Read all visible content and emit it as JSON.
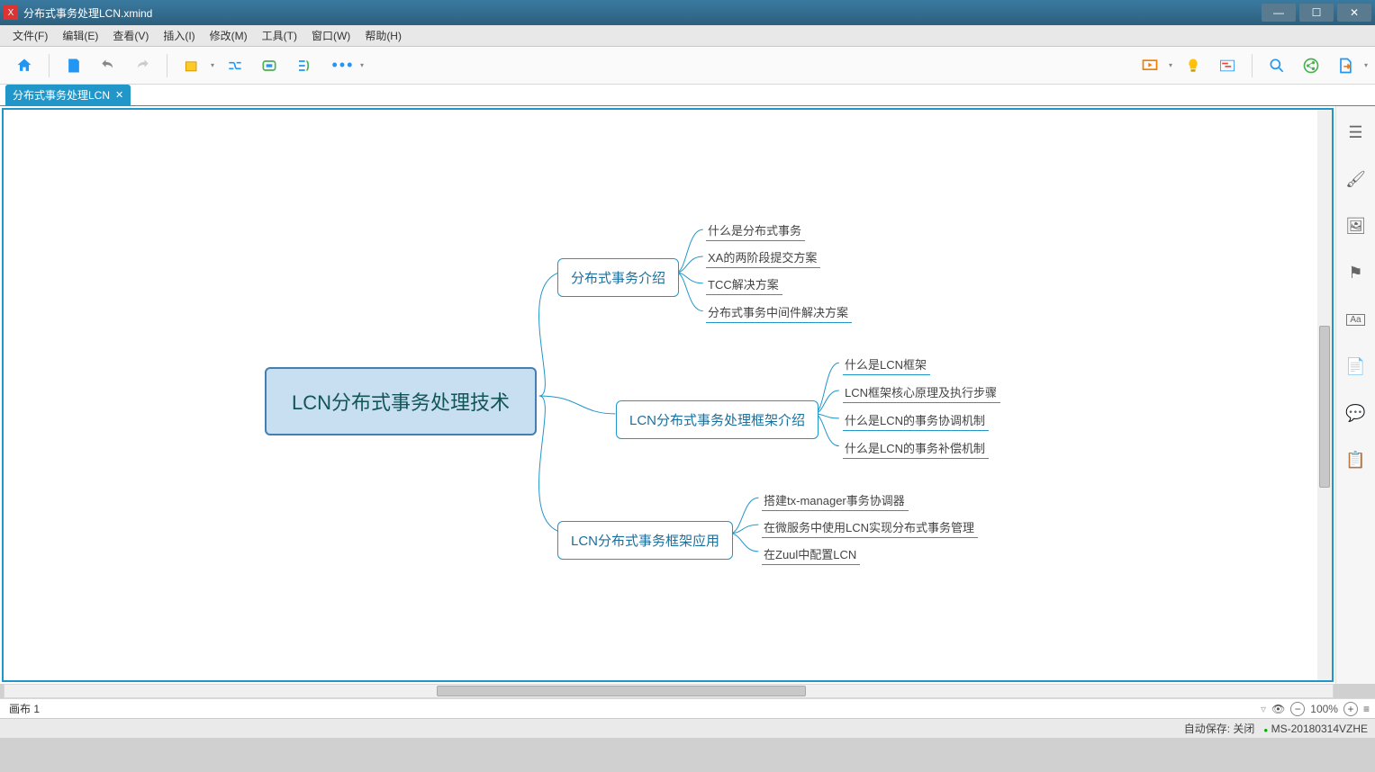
{
  "window": {
    "title": "分布式事务处理LCN.xmind"
  },
  "menu": [
    "文件(F)",
    "编辑(E)",
    "查看(V)",
    "插入(I)",
    "修改(M)",
    "工具(T)",
    "窗口(W)",
    "帮助(H)"
  ],
  "tab": {
    "label": "分布式事务处理LCN"
  },
  "sheet": {
    "label": "画布 1"
  },
  "zoom": {
    "value": "100%"
  },
  "status": {
    "autosave": "自动保存: 关闭",
    "host": "MS-20180314VZHE"
  },
  "mindmap": {
    "root": "LCN分布式事务处理技术",
    "branches": [
      {
        "title": "分布式事务介绍",
        "leaves": [
          "什么是分布式事务",
          "XA的两阶段提交方案",
          "TCC解决方案",
          "分布式事务中间件解决方案"
        ]
      },
      {
        "title": "LCN分布式事务处理框架介绍",
        "leaves": [
          "什么是LCN框架",
          "LCN框架核心原理及执行步骤",
          "什么是LCN的事务协调机制",
          "什么是LCN的事务补偿机制"
        ]
      },
      {
        "title": "LCN分布式事务框架应用",
        "leaves": [
          "搭建tx-manager事务协调器",
          "在微服务中使用LCN实现分布式事务管理",
          "在Zuul中配置LCN"
        ]
      }
    ]
  },
  "chart_data": {
    "type": "table",
    "title": "LCN分布式事务处理技术",
    "series": [
      {
        "name": "分布式事务介绍",
        "values": [
          "什么是分布式事务",
          "XA的两阶段提交方案",
          "TCC解决方案",
          "分布式事务中间件解决方案"
        ]
      },
      {
        "name": "LCN分布式事务处理框架介绍",
        "values": [
          "什么是LCN框架",
          "LCN框架核心原理及执行步骤",
          "什么是LCN的事务协调机制",
          "什么是LCN的事务补偿机制"
        ]
      },
      {
        "name": "LCN分布式事务框架应用",
        "values": [
          "搭建tx-manager事务协调器",
          "在微服务中使用LCN实现分布式事务管理",
          "在Zuul中配置LCN"
        ]
      }
    ]
  }
}
